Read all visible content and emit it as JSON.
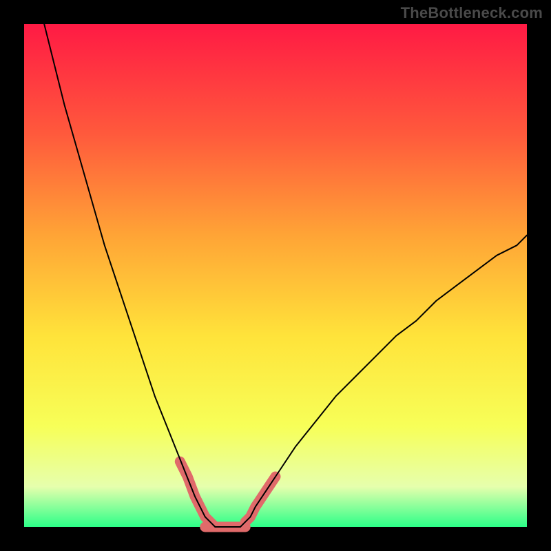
{
  "watermark": "TheBottleneck.com",
  "chart_data": {
    "type": "line",
    "title": "",
    "xlabel": "",
    "ylabel": "",
    "xlim": [
      0,
      100
    ],
    "ylim": [
      0,
      100
    ],
    "gradient_stops": [
      {
        "offset": 0,
        "color": "#ff1a44"
      },
      {
        "offset": 22,
        "color": "#ff5a3c"
      },
      {
        "offset": 42,
        "color": "#ffa436"
      },
      {
        "offset": 62,
        "color": "#ffe33a"
      },
      {
        "offset": 80,
        "color": "#f7ff58"
      },
      {
        "offset": 92,
        "color": "#e6ffad"
      },
      {
        "offset": 100,
        "color": "#2cff88"
      }
    ],
    "series": [
      {
        "name": "left-curve",
        "x": [
          4,
          6,
          8,
          10,
          12,
          14,
          16,
          18,
          20,
          22,
          24,
          26,
          28,
          30,
          32,
          34,
          35,
          36,
          37,
          38
        ],
        "y": [
          100,
          92,
          84,
          77,
          70,
          63,
          56,
          50,
          44,
          38,
          32,
          26,
          21,
          16,
          11,
          6,
          4,
          2,
          1,
          0
        ]
      },
      {
        "name": "right-curve",
        "x": [
          43,
          44,
          45,
          46,
          48,
          50,
          54,
          58,
          62,
          66,
          70,
          74,
          78,
          82,
          86,
          90,
          94,
          98,
          100
        ],
        "y": [
          0,
          1,
          2,
          4,
          7,
          10,
          16,
          21,
          26,
          30,
          34,
          38,
          41,
          45,
          48,
          51,
          54,
          56,
          58
        ]
      },
      {
        "name": "valley-floor",
        "x": [
          38,
          40,
          41,
          42,
          43
        ],
        "y": [
          0,
          0,
          0,
          0,
          0
        ]
      }
    ],
    "highlights": [
      {
        "name": "left-highlight",
        "color": "#e06a6a",
        "width": 15,
        "x": [
          31,
          32.5,
          34,
          35,
          36,
          37,
          38
        ],
        "y": [
          13,
          10,
          6,
          4,
          2,
          1,
          0
        ]
      },
      {
        "name": "floor-highlight",
        "color": "#e06a6a",
        "width": 15,
        "x": [
          36,
          38,
          40,
          42,
          44
        ],
        "y": [
          0,
          0,
          0,
          0,
          0
        ]
      },
      {
        "name": "right-highlight",
        "color": "#e06a6a",
        "width": 15,
        "x": [
          44,
          45,
          46,
          47,
          48,
          49,
          50
        ],
        "y": [
          1,
          2,
          4,
          5.5,
          7,
          8.5,
          10
        ]
      }
    ]
  }
}
